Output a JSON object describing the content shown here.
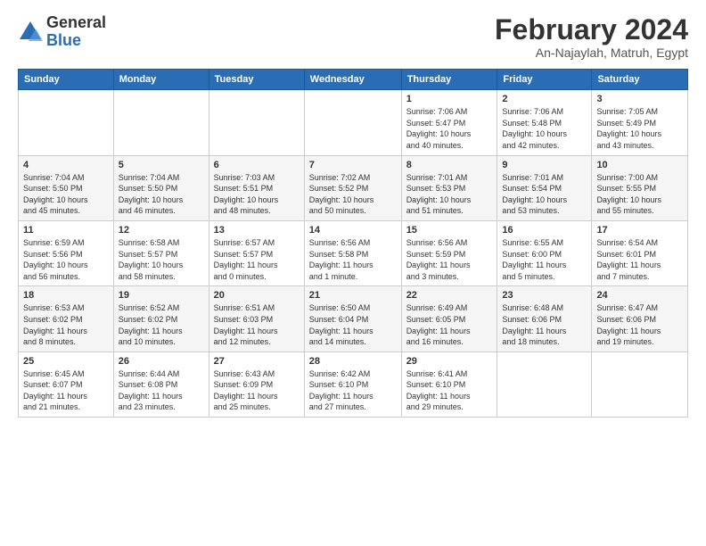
{
  "logo": {
    "general": "General",
    "blue": "Blue"
  },
  "title": "February 2024",
  "subtitle": "An-Najaylah, Matruh, Egypt",
  "days_header": [
    "Sunday",
    "Monday",
    "Tuesday",
    "Wednesday",
    "Thursday",
    "Friday",
    "Saturday"
  ],
  "weeks": [
    [
      {
        "day": "",
        "info": ""
      },
      {
        "day": "",
        "info": ""
      },
      {
        "day": "",
        "info": ""
      },
      {
        "day": "",
        "info": ""
      },
      {
        "day": "1",
        "info": "Sunrise: 7:06 AM\nSunset: 5:47 PM\nDaylight: 10 hours\nand 40 minutes."
      },
      {
        "day": "2",
        "info": "Sunrise: 7:06 AM\nSunset: 5:48 PM\nDaylight: 10 hours\nand 42 minutes."
      },
      {
        "day": "3",
        "info": "Sunrise: 7:05 AM\nSunset: 5:49 PM\nDaylight: 10 hours\nand 43 minutes."
      }
    ],
    [
      {
        "day": "4",
        "info": "Sunrise: 7:04 AM\nSunset: 5:50 PM\nDaylight: 10 hours\nand 45 minutes."
      },
      {
        "day": "5",
        "info": "Sunrise: 7:04 AM\nSunset: 5:50 PM\nDaylight: 10 hours\nand 46 minutes."
      },
      {
        "day": "6",
        "info": "Sunrise: 7:03 AM\nSunset: 5:51 PM\nDaylight: 10 hours\nand 48 minutes."
      },
      {
        "day": "7",
        "info": "Sunrise: 7:02 AM\nSunset: 5:52 PM\nDaylight: 10 hours\nand 50 minutes."
      },
      {
        "day": "8",
        "info": "Sunrise: 7:01 AM\nSunset: 5:53 PM\nDaylight: 10 hours\nand 51 minutes."
      },
      {
        "day": "9",
        "info": "Sunrise: 7:01 AM\nSunset: 5:54 PM\nDaylight: 10 hours\nand 53 minutes."
      },
      {
        "day": "10",
        "info": "Sunrise: 7:00 AM\nSunset: 5:55 PM\nDaylight: 10 hours\nand 55 minutes."
      }
    ],
    [
      {
        "day": "11",
        "info": "Sunrise: 6:59 AM\nSunset: 5:56 PM\nDaylight: 10 hours\nand 56 minutes."
      },
      {
        "day": "12",
        "info": "Sunrise: 6:58 AM\nSunset: 5:57 PM\nDaylight: 10 hours\nand 58 minutes."
      },
      {
        "day": "13",
        "info": "Sunrise: 6:57 AM\nSunset: 5:57 PM\nDaylight: 11 hours\nand 0 minutes."
      },
      {
        "day": "14",
        "info": "Sunrise: 6:56 AM\nSunset: 5:58 PM\nDaylight: 11 hours\nand 1 minute."
      },
      {
        "day": "15",
        "info": "Sunrise: 6:56 AM\nSunset: 5:59 PM\nDaylight: 11 hours\nand 3 minutes."
      },
      {
        "day": "16",
        "info": "Sunrise: 6:55 AM\nSunset: 6:00 PM\nDaylight: 11 hours\nand 5 minutes."
      },
      {
        "day": "17",
        "info": "Sunrise: 6:54 AM\nSunset: 6:01 PM\nDaylight: 11 hours\nand 7 minutes."
      }
    ],
    [
      {
        "day": "18",
        "info": "Sunrise: 6:53 AM\nSunset: 6:02 PM\nDaylight: 11 hours\nand 8 minutes."
      },
      {
        "day": "19",
        "info": "Sunrise: 6:52 AM\nSunset: 6:02 PM\nDaylight: 11 hours\nand 10 minutes."
      },
      {
        "day": "20",
        "info": "Sunrise: 6:51 AM\nSunset: 6:03 PM\nDaylight: 11 hours\nand 12 minutes."
      },
      {
        "day": "21",
        "info": "Sunrise: 6:50 AM\nSunset: 6:04 PM\nDaylight: 11 hours\nand 14 minutes."
      },
      {
        "day": "22",
        "info": "Sunrise: 6:49 AM\nSunset: 6:05 PM\nDaylight: 11 hours\nand 16 minutes."
      },
      {
        "day": "23",
        "info": "Sunrise: 6:48 AM\nSunset: 6:06 PM\nDaylight: 11 hours\nand 18 minutes."
      },
      {
        "day": "24",
        "info": "Sunrise: 6:47 AM\nSunset: 6:06 PM\nDaylight: 11 hours\nand 19 minutes."
      }
    ],
    [
      {
        "day": "25",
        "info": "Sunrise: 6:45 AM\nSunset: 6:07 PM\nDaylight: 11 hours\nand 21 minutes."
      },
      {
        "day": "26",
        "info": "Sunrise: 6:44 AM\nSunset: 6:08 PM\nDaylight: 11 hours\nand 23 minutes."
      },
      {
        "day": "27",
        "info": "Sunrise: 6:43 AM\nSunset: 6:09 PM\nDaylight: 11 hours\nand 25 minutes."
      },
      {
        "day": "28",
        "info": "Sunrise: 6:42 AM\nSunset: 6:10 PM\nDaylight: 11 hours\nand 27 minutes."
      },
      {
        "day": "29",
        "info": "Sunrise: 6:41 AM\nSunset: 6:10 PM\nDaylight: 11 hours\nand 29 minutes."
      },
      {
        "day": "",
        "info": ""
      },
      {
        "day": "",
        "info": ""
      }
    ]
  ]
}
